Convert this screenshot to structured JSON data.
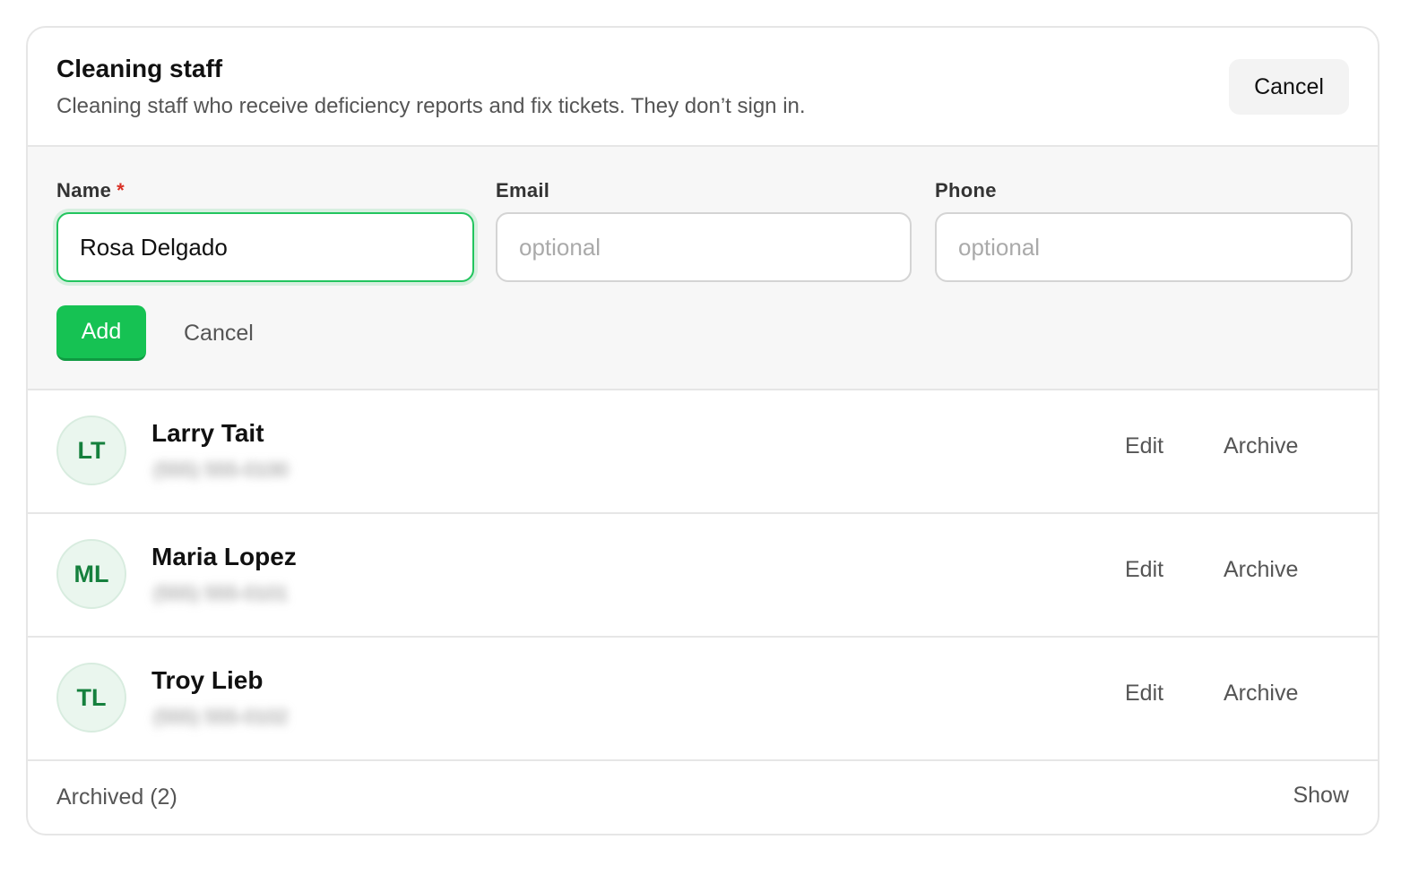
{
  "header": {
    "title": "Cleaning staff",
    "subtitle": "Cleaning staff who receive deficiency reports and fix tickets. They don’t sign in.",
    "cancel_label": "Cancel"
  },
  "form": {
    "name": {
      "label": "Name",
      "required_mark": "*",
      "value": "Rosa Delgado"
    },
    "email": {
      "label": "Email",
      "placeholder": "optional",
      "value": ""
    },
    "phone": {
      "label": "Phone",
      "placeholder": "optional",
      "value": ""
    },
    "add_label": "Add",
    "cancel_label": "Cancel"
  },
  "staff": [
    {
      "initials": "LT",
      "name": "Larry Tait",
      "sub": "(555) 555-0100",
      "edit_label": "Edit",
      "archive_label": "Archive"
    },
    {
      "initials": "ML",
      "name": "Maria Lopez",
      "sub": "(555) 555-0101",
      "edit_label": "Edit",
      "archive_label": "Archive"
    },
    {
      "initials": "TL",
      "name": "Troy Lieb",
      "sub": "(555) 555-0102",
      "edit_label": "Edit",
      "archive_label": "Archive"
    }
  ],
  "footer": {
    "archived_label": "Archived (2)",
    "show_label": "Show"
  },
  "colors": {
    "accent": "#16c253",
    "avatar_text": "#15803d",
    "avatar_bg": "#eaf6ee",
    "required": "#d93025"
  }
}
